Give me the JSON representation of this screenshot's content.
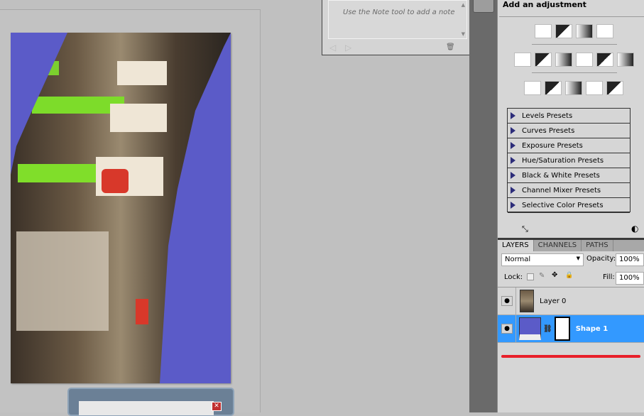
{
  "notes": {
    "hint": "Use the Note tool to add a note"
  },
  "adjustments": {
    "title": "Add an adjustment",
    "row1": [
      "brightness-contrast-icon",
      "levels-icon",
      "curves-icon",
      "exposure-icon"
    ],
    "row2": [
      "vibrance-icon",
      "hue-saturation-icon",
      "color-balance-icon",
      "black-white-icon",
      "photo-filter-icon",
      "channel-mixer-icon"
    ],
    "row3": [
      "invert-icon",
      "posterize-icon",
      "threshold-icon",
      "gradient-map-icon",
      "selective-color-icon"
    ],
    "presets": [
      "Levels Presets",
      "Curves Presets",
      "Exposure Presets",
      "Hue/Saturation Presets",
      "Black & White Presets",
      "Channel Mixer Presets",
      "Selective Color Presets"
    ]
  },
  "layers": {
    "tabs": [
      "LAYERS",
      "CHANNELS",
      "PATHS"
    ],
    "blend_mode": "Normal",
    "opacity_label": "Opacity:",
    "opacity": "100%",
    "lock_label": "Lock:",
    "fill_label": "Fill:",
    "fill": "100%",
    "items": [
      {
        "name": "Layer 0",
        "selected": false
      },
      {
        "name": "Shape 1",
        "selected": true
      }
    ]
  },
  "colors": {
    "shape": "#5b5bc8",
    "selection": "#3399ff",
    "red_line": "#e8202a"
  }
}
